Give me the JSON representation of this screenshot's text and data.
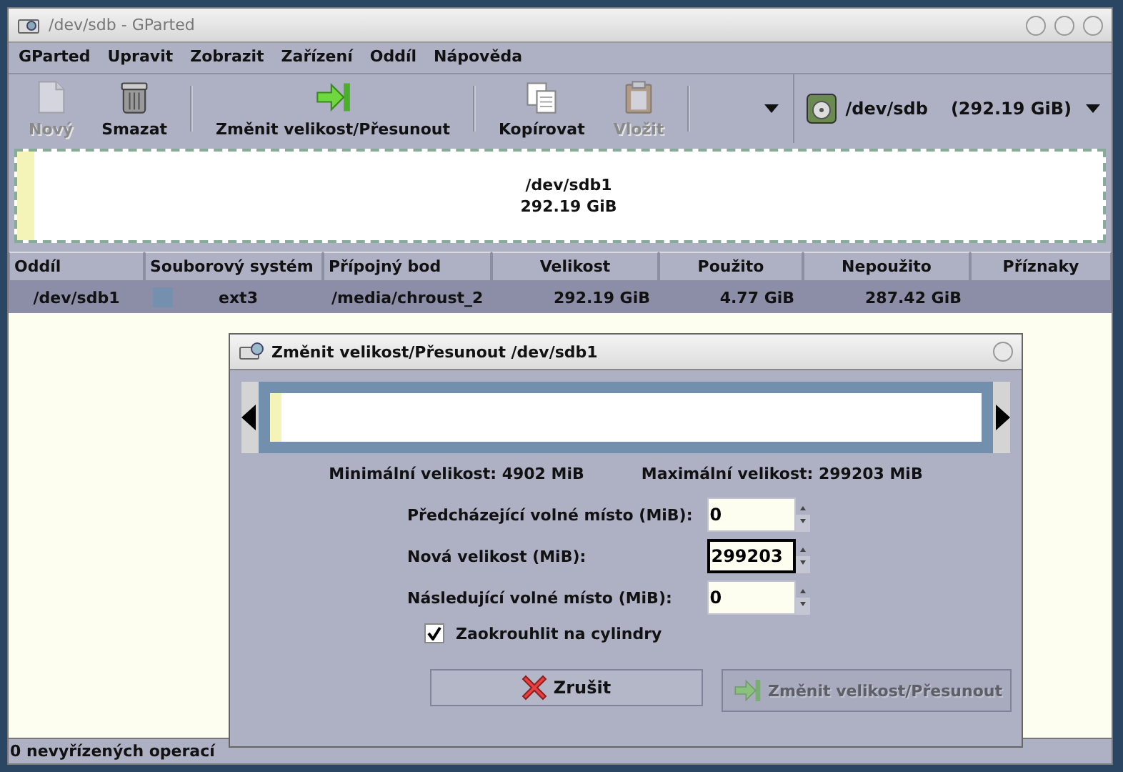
{
  "window": {
    "title": "/dev/sdb - GParted"
  },
  "menu": [
    "GParted",
    "Upravit",
    "Zobrazit",
    "Zařízení",
    "Oddíl",
    "Nápověda"
  ],
  "toolbar": [
    {
      "kind": "new",
      "label": "Nový",
      "disabled": true
    },
    {
      "kind": "delete",
      "label": "Smazat",
      "disabled": false
    },
    {
      "kind": "resize",
      "label": "Změnit velikost/Přesunout",
      "disabled": false
    },
    {
      "kind": "copy",
      "label": "Kopírovat",
      "disabled": false
    },
    {
      "kind": "paste",
      "label": "Vložit",
      "disabled": true
    }
  ],
  "device": {
    "name": "/dev/sdb",
    "size": "(292.19 GiB)"
  },
  "partition_map": {
    "name": "/dev/sdb1",
    "size": "292.19 GiB"
  },
  "table": {
    "columns": [
      "Oddíl",
      "Souborový systém",
      "Přípojný bod",
      "Velikost",
      "Použito",
      "Nepoužito",
      "Příznaky"
    ],
    "rows": [
      {
        "partition": "/dev/sdb1",
        "color": "#7590ae",
        "filesystem": "ext3",
        "mount": "/media/chroust_2",
        "size": "292.19 GiB",
        "used": "4.77 GiB",
        "unused": "287.42 GiB",
        "selected": true
      }
    ]
  },
  "dialog": {
    "title": "Změnit velikost/Přesunout /dev/sdb1",
    "min": "Minimální velikost: 4902 MiB",
    "max": "Maximální velikost: 299203 MiB",
    "fields": [
      {
        "label": "Předcházející volné místo (MiB):",
        "value": "0",
        "focused": false
      },
      {
        "label": "Nová velikost (MiB):",
        "value": "299203",
        "focused": true
      },
      {
        "label": "Následující volné místo (MiB):",
        "value": "0",
        "focused": false
      }
    ],
    "checkbox": {
      "label": "Zaokrouhlit na cylindry",
      "checked": true
    },
    "buttons": [
      {
        "kind": "cancel",
        "label": "Zrušit",
        "disabled": false
      },
      {
        "kind": "resize",
        "label": "Změnit velikost/Přesunout",
        "disabled": true
      }
    ]
  },
  "status_bar": "0 nevyřízených operací"
}
